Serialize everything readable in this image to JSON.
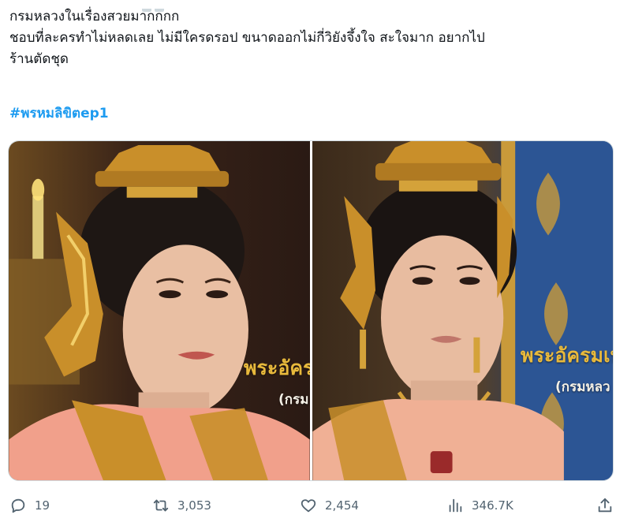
{
  "tweet": {
    "lines": [
      "กรมหลวงในเรื่องสวยมากกกก",
      "ชอบที่ละครทำไม่หลดเลย ไม่มีใครดรอป ขนาดออกไม่กี่วิยังจึ้งใจ สะใจมาก อยากไป",
      "ร้านตัดชุด"
    ],
    "hashtag": "#พรหมลิขิตep1"
  },
  "media": {
    "left": {
      "caption_main": "พระอัครม",
      "caption_sub": "(กรม"
    },
    "right": {
      "caption_main": "พระอัครมเห",
      "caption_sub": "(กรมหลว"
    }
  },
  "actions": {
    "replies": "19",
    "reposts": "3,053",
    "likes": "2,454",
    "views": "346.7K"
  },
  "colors": {
    "accent": "#1d9bf0",
    "text": "#0f1419",
    "muted": "#536471",
    "caption_gold": "#e8b93c"
  },
  "icons": [
    "reply-icon",
    "repost-icon",
    "like-icon",
    "views-icon",
    "share-icon"
  ]
}
